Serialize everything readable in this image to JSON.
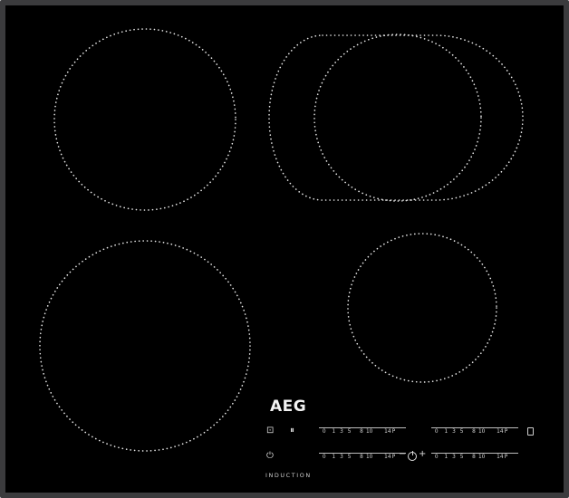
{
  "brand": {
    "logo": "AEG",
    "label": "INDUCTION"
  },
  "zones": [
    {
      "name": "front-left",
      "shape": "circle"
    },
    {
      "name": "rear-left",
      "shape": "circle"
    },
    {
      "name": "rear-right",
      "shape": "bridge-oval"
    },
    {
      "name": "front-right",
      "shape": "circle"
    }
  ],
  "controls": {
    "slider_ticks": [
      "0",
      "1",
      "3",
      "5",
      "8",
      "10",
      "14",
      "P"
    ],
    "timer": {
      "minus": "−",
      "plus": "+"
    },
    "icons": {
      "lock": "lock-icon",
      "pause": "pause-icon",
      "power": "power-icon",
      "timer": "timer-icon",
      "bridge": "bridge-icon"
    },
    "lock_symbol": "⊡",
    "pause_symbol": "⏸",
    "power_symbol": "⏻"
  },
  "colors": {
    "glass": "#000000",
    "frame": "#3b3b3d",
    "print": "#e8e8e8"
  }
}
